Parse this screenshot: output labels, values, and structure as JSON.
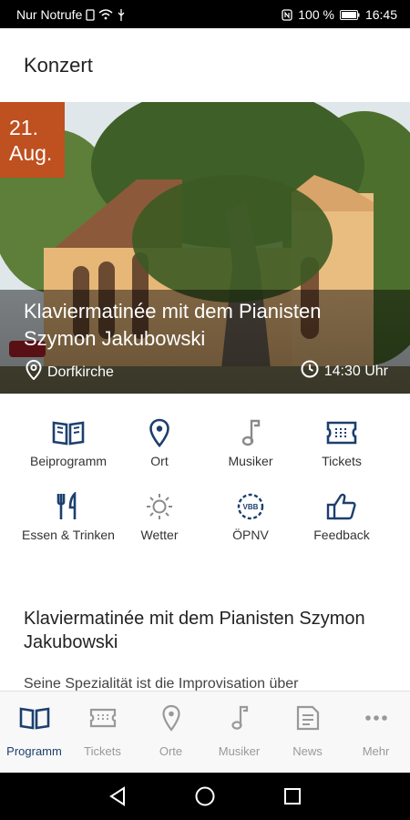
{
  "status_bar": {
    "carrier": "Nur Notrufe",
    "battery": "100 %",
    "time": "16:45"
  },
  "app_bar": {
    "title": "Konzert"
  },
  "event": {
    "date_day": "21.",
    "date_month": "Aug.",
    "title": "Klaviermatinée mit dem Pianisten Szymon Jakubowski",
    "location": "Dorfkirche",
    "time": "14:30 Uhr"
  },
  "actions": [
    {
      "label": "Beiprogramm",
      "icon": "book-icon",
      "enabled": true
    },
    {
      "label": "Ort",
      "icon": "location-pin-icon",
      "enabled": true
    },
    {
      "label": "Musiker",
      "icon": "music-note-icon",
      "enabled": false
    },
    {
      "label": "Tickets",
      "icon": "ticket-icon",
      "enabled": true
    },
    {
      "label": "Essen & Trinken",
      "icon": "fork-knife-icon",
      "enabled": true
    },
    {
      "label": "Wetter",
      "icon": "sun-icon",
      "enabled": false
    },
    {
      "label": "ÖPNV",
      "icon": "vbb-transit-icon",
      "enabled": true
    },
    {
      "label": "Feedback",
      "icon": "thumbs-up-icon",
      "enabled": true
    }
  ],
  "content": {
    "title": "Klaviermatinée mit dem Pianisten Szymon Jakubowski",
    "text_preview": "Seine Spezialität ist die Improvisation über"
  },
  "bottom_nav": [
    {
      "label": "Programm",
      "icon": "book-icon",
      "active": true
    },
    {
      "label": "Tickets",
      "icon": "ticket-icon",
      "active": false
    },
    {
      "label": "Orte",
      "icon": "location-pin-icon",
      "active": false
    },
    {
      "label": "Musiker",
      "icon": "music-note-icon",
      "active": false
    },
    {
      "label": "News",
      "icon": "news-icon",
      "active": false
    },
    {
      "label": "Mehr",
      "icon": "more-icon",
      "active": false
    }
  ],
  "colors": {
    "accent_navy": "#1c3f6e",
    "date_badge": "#bf5020",
    "disabled_icon": "#8a8a8a"
  }
}
